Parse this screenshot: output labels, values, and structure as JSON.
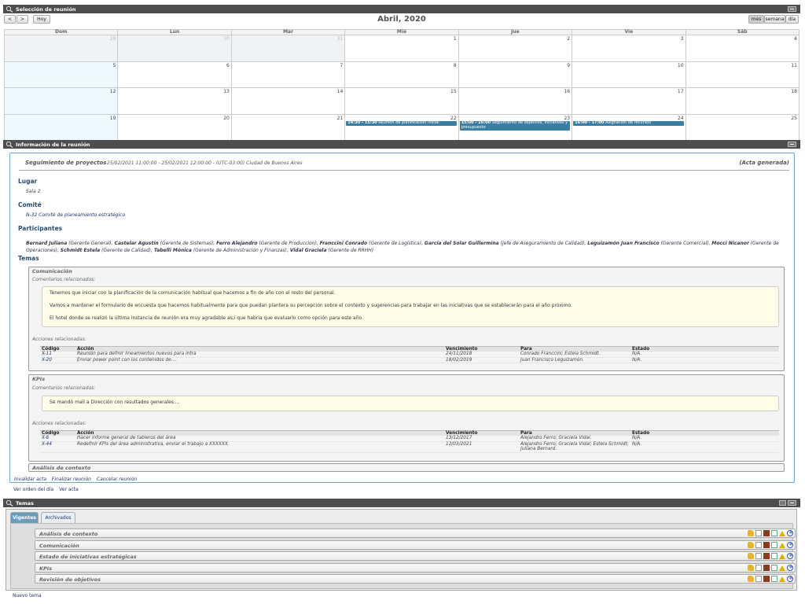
{
  "calendar": {
    "panel_title": "Selección de reunión",
    "prev": "<",
    "next": ">",
    "today": "Hoy",
    "month_title": "Abril, 2020",
    "views": [
      "mes",
      "semana",
      "día"
    ],
    "day_names": [
      "Dom",
      "Lun",
      "Mar",
      "Mié",
      "Jue",
      "Vie",
      "Sáb"
    ],
    "weeks": [
      [
        {
          "n": "29",
          "other": true
        },
        {
          "n": "30",
          "other": true
        },
        {
          "n": "31",
          "other": true
        },
        {
          "n": "1"
        },
        {
          "n": "2"
        },
        {
          "n": "3"
        },
        {
          "n": "4"
        }
      ],
      [
        {
          "n": "5",
          "today": true
        },
        {
          "n": "6"
        },
        {
          "n": "7"
        },
        {
          "n": "8"
        },
        {
          "n": "9"
        },
        {
          "n": "10"
        },
        {
          "n": "11"
        }
      ],
      [
        {
          "n": "12",
          "today": true
        },
        {
          "n": "13"
        },
        {
          "n": "14"
        },
        {
          "n": "15"
        },
        {
          "n": "16"
        },
        {
          "n": "17"
        },
        {
          "n": "18"
        }
      ],
      [
        {
          "n": "19",
          "today": true
        },
        {
          "n": "20"
        },
        {
          "n": "21"
        },
        {
          "n": "22",
          "event_time": "14:30 - 15:30",
          "event_title": "Reunión de planificación inicial"
        },
        {
          "n": "23",
          "event_time": "15:00 - 16:00",
          "event_title": "Seguimiento de objetivos, iniciativas y presupuesto"
        },
        {
          "n": "24",
          "event_time": "16:00 - 17:00",
          "event_title": "Asignación de recursos"
        },
        {
          "n": "25"
        }
      ]
    ]
  },
  "info": {
    "panel_title": "Información de la reunión",
    "meeting_title": "Seguimiento de proyectos",
    "meeting_dates": "25/02/2021 11:00:00 - 25/02/2021 12:00:00 - (UTC-03:00) Ciudad de Buenos Aires",
    "status": "(Acta generada)",
    "lugar_label": "Lugar",
    "lugar_value": "Sala 2",
    "comite_label": "Comité",
    "comite_value": "N-32 Comité de planeamiento estratégico",
    "participantes_label": "Participantes",
    "participantes": [
      {
        "name": "Bernard Juliana",
        "role": "(Gerente General)"
      },
      {
        "name": "Castelar Agustín",
        "role": "(Gerente de Sistemas)"
      },
      {
        "name": "Ferro Alejandro",
        "role": "(Gerente de Producción)"
      },
      {
        "name": "Franccini Conrado",
        "role": "(Gerente de Logística)"
      },
      {
        "name": "García del Solar Guillermina",
        "role": "(Jefe de Aseguramiento de Calidad)"
      },
      {
        "name": "Leguizamón Juan Francisco",
        "role": "(Gerente Comercial)"
      },
      {
        "name": "Mocci Nicanor",
        "role": "(Gerente de Operaciones)"
      },
      {
        "name": "Schmidt Estela",
        "role": "(Gerente de Calidad)"
      },
      {
        "name": "Tabelli Mónica",
        "role": "(Gerente de Administración y Finanzas)"
      },
      {
        "name": "Vidal Graciela",
        "role": "(Gerente de RRHH)"
      }
    ],
    "temas_label": "Temas",
    "comentarios_label": "Comentarios relacionados:",
    "acciones_label": "Acciones relacionadas:",
    "col_headers": [
      "Código",
      "Acción",
      "Vencimiento",
      "Para",
      "Estado"
    ],
    "topics": [
      {
        "title": "Comunicación",
        "comments": [
          "Tenemos que iniciar con la planificación de la comunicación habitual que hacemos a fin de año con el resto del personal.",
          "Vamos a mantener el formulario de encuesta que hacemos habitualmente para que puedan plantera su percepción sobre el contexto y sugerencias para trabajar en las iniciativas que se establecerán para el año próximo.",
          "El hotel donde se realizó la última instancia de reunión era muy agradable as;i que habría que evaluarlo como opción para este año."
        ],
        "actions": [
          {
            "codigo": "X-11",
            "accion": "Reunión para definir lineamientos nuevos para intra",
            "venc": "24/11/2018",
            "para": "Conrado Franccini; Estela Schmidt.",
            "estado": "N/A."
          },
          {
            "codigo": "X-20",
            "accion": "Enviar power point con los contenidos de....",
            "venc": "18/02/2019",
            "para": "Juan Francisco Leguizamón.",
            "estado": "N/A."
          }
        ]
      },
      {
        "title": "KPIs",
        "comments": [
          "Se mandó mail a Dirección con resultados generales...."
        ],
        "actions": [
          {
            "codigo": "X-6",
            "accion": "Hacer informe general de tableros del área",
            "venc": "13/12/2017",
            "para": "Alejandro Ferro; Graciela Vidal.",
            "estado": "N/A."
          },
          {
            "codigo": "X-44",
            "accion": "Redefinir KPIs del área administrativa, enviar el trabajo a XXXXXX.",
            "venc": "12/03/2021",
            "para": "Alejandro Ferro; Graciela Vidal; Estela Schmidt; Juliana Bernard.",
            "estado": "N/A."
          }
        ]
      }
    ],
    "collapsed_topic": "Análisis de contexto",
    "footer_links": [
      "Invalidar acta",
      "Finalizar reunión",
      "Cancelar reunión"
    ],
    "outer_links": [
      "Ver orden del día",
      "Ver acta"
    ]
  },
  "temas": {
    "panel_title": "Temas",
    "tabs": [
      "Vigentes",
      "Archivados"
    ],
    "rows": [
      "Análisis de contexto",
      "Comunicación",
      "Estado de iniciativas estratégicas",
      "KPIs",
      "Revisión de objetivos"
    ],
    "new_link": "Nuevo tema"
  }
}
